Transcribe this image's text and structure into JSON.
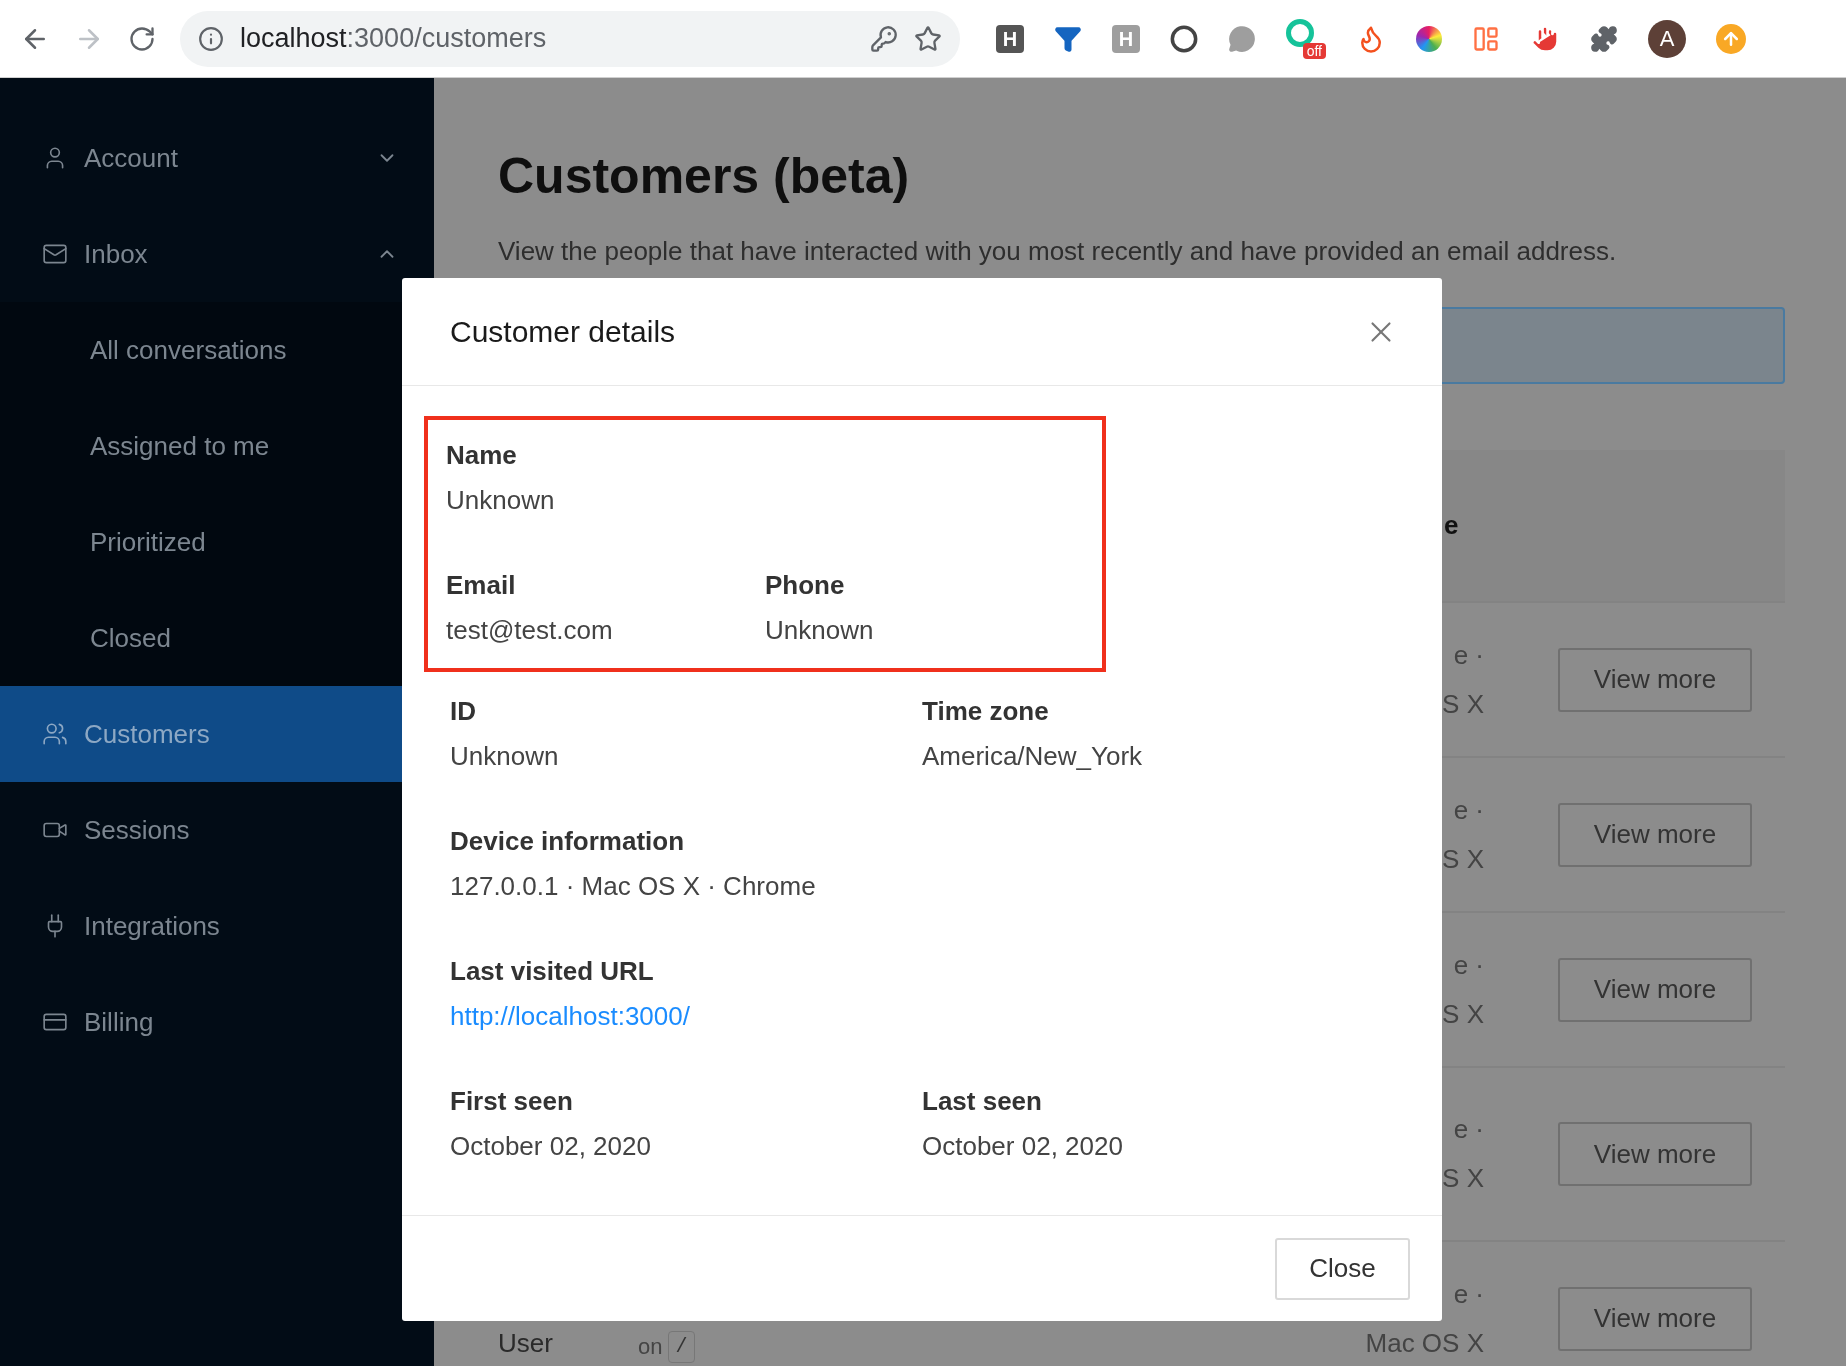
{
  "browser": {
    "url_host": "localhost",
    "url_path": ":3000/customers",
    "extensions": [
      {
        "kind": "letter",
        "text": "H",
        "color": "#555555"
      },
      {
        "kind": "funnel",
        "color": "#1565c0"
      },
      {
        "kind": "letter",
        "text": "H",
        "color": "#9e9e9e"
      },
      {
        "kind": "ring",
        "color": "#444444"
      },
      {
        "kind": "bubble",
        "color": "#9e9e9e"
      },
      {
        "kind": "badge",
        "text": "off",
        "color": "#15c39a"
      },
      {
        "kind": "fire",
        "color": "#f4511e"
      },
      {
        "kind": "wheel"
      },
      {
        "kind": "layout",
        "color": "#ff7043"
      },
      {
        "kind": "hand",
        "color": "#e53935"
      },
      {
        "kind": "puzzle",
        "color": "#5f6368"
      },
      {
        "kind": "avatar",
        "text": "A",
        "color": "#5d4037"
      },
      {
        "kind": "update",
        "color": "#f9a825"
      }
    ]
  },
  "sidebar": {
    "items": [
      {
        "label": "Account",
        "kind": "user",
        "selected": false,
        "expanded": false
      },
      {
        "label": "Inbox",
        "kind": "mail",
        "selected": false,
        "expanded": true,
        "children": [
          {
            "label": "All conversations",
            "selected": false
          },
          {
            "label": "Assigned to me",
            "selected": false
          },
          {
            "label": "Prioritized",
            "selected": false
          },
          {
            "label": "Closed",
            "selected": false
          }
        ]
      },
      {
        "label": "Customers",
        "kind": "users",
        "selected": true
      },
      {
        "label": "Sessions",
        "kind": "video",
        "selected": false
      },
      {
        "label": "Integrations",
        "kind": "plug",
        "selected": false
      },
      {
        "label": "Billing",
        "kind": "card",
        "selected": false
      }
    ]
  },
  "page": {
    "title": "Customers (beta)",
    "subtitle": "View the people that have interacted with you most recently and have provided an email address.",
    "table_header_fragment": "e",
    "rows": [
      {
        "line_1": "e ·",
        "line_2": "S X",
        "button": "View more"
      },
      {
        "line_1": "e ·",
        "line_2": "S X",
        "button": "View more"
      },
      {
        "line_1": "e ·",
        "line_2": "S X",
        "button": "View more"
      },
      {
        "line_1": "e ·",
        "line_2": "S X",
        "button": "View more"
      },
      {
        "line_1": "e ·",
        "line_2": "Mac OS X",
        "button": "View more",
        "user": "User",
        "on": "on",
        "path": "/"
      }
    ]
  },
  "modal": {
    "title": "Customer details",
    "sections": [
      {
        "highlighted": true,
        "rows": [
          [
            {
              "label": "Name",
              "value": "Unknown"
            }
          ],
          [
            {
              "label": "Email",
              "value": "test@test.com"
            },
            {
              "label": "Phone",
              "value": "Unknown"
            }
          ]
        ]
      },
      {
        "highlighted": false,
        "rows": [
          [
            {
              "label": "ID",
              "value": "Unknown"
            },
            {
              "label": "Time zone",
              "value": "America/New_York"
            }
          ],
          [
            {
              "label": "Device information",
              "value": "127.0.0.1 · Mac OS X · Chrome"
            }
          ],
          [
            {
              "label": "Last visited URL",
              "value": "http://localhost:3000/",
              "kind": "link"
            }
          ],
          [
            {
              "label": "First seen",
              "value": "October 02, 2020"
            },
            {
              "label": "Last seen",
              "value": "October 02, 2020"
            }
          ]
        ]
      }
    ],
    "close_button": "Close"
  }
}
